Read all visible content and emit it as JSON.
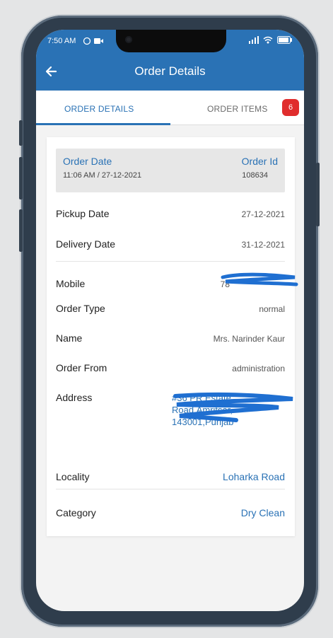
{
  "status_bar": {
    "time": "7:50 AM",
    "icons": [
      "alarm-icon",
      "video-icon"
    ]
  },
  "app_bar": {
    "title": "Order Details"
  },
  "tabs": [
    {
      "label": "ORDER DETAILS",
      "active": true
    },
    {
      "label": "ORDER ITEMS",
      "active": false,
      "badge": "6"
    }
  ],
  "order": {
    "date_label": "Order Date",
    "date_value": "11:06 AM / 27-12-2021",
    "id_label": "Order Id",
    "id_value": "108634"
  },
  "details": {
    "pickup_date": {
      "label": "Pickup Date",
      "value": "27-12-2021"
    },
    "delivery_date": {
      "label": "Delivery Date",
      "value": "31-12-2021"
    },
    "mobile": {
      "label": "Mobile",
      "value": "78"
    },
    "order_type": {
      "label": "Order Type",
      "value": "normal"
    },
    "name": {
      "label": "Name",
      "value": "Mrs. Narinder Kaur"
    },
    "order_from": {
      "label": "Order From",
      "value": "administration"
    },
    "address": {
      "label": "Address",
      "line1": "#36 PR Estate",
      "line2": "Road,Amritsar,",
      "line3": "143001,Punjab"
    },
    "locality": {
      "label": "Locality",
      "value": "Loharka Road"
    },
    "category": {
      "label": "Category",
      "value": "Dry Clean"
    }
  },
  "colors": {
    "primary": "#2a72b5",
    "badge": "#e02d2d",
    "redaction": "#1f6fd1"
  }
}
